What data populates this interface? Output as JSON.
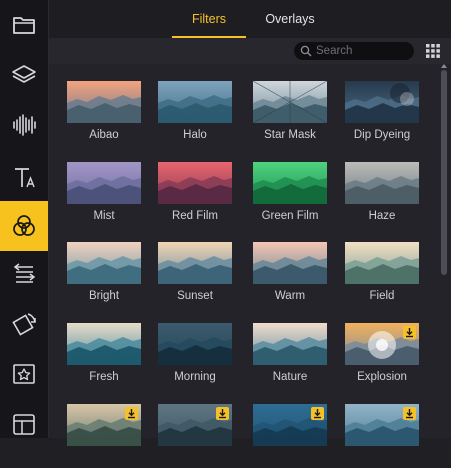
{
  "tabs": [
    {
      "label": "Filters"
    },
    {
      "label": "Overlays"
    }
  ],
  "search": {
    "placeholder": "Search"
  },
  "accent_color": "#f5c12a",
  "sidebar": {
    "items": [
      {
        "icon": "folder-icon"
      },
      {
        "icon": "layers-icon"
      },
      {
        "icon": "audio-waveform-icon"
      },
      {
        "icon": "text-icon"
      },
      {
        "icon": "filters-circles-icon",
        "active": true
      },
      {
        "icon": "transitions-icon"
      },
      {
        "icon": "rotate-square-icon"
      },
      {
        "icon": "star-sticker-icon"
      },
      {
        "icon": "template-icon"
      }
    ]
  },
  "filters": [
    {
      "label": "Aibao",
      "download": false
    },
    {
      "label": "Halo",
      "download": false
    },
    {
      "label": "Star Mask",
      "download": false
    },
    {
      "label": "Dip Dyeing",
      "download": false
    },
    {
      "label": "Mist",
      "download": false
    },
    {
      "label": "Red Film",
      "download": false
    },
    {
      "label": "Green Film",
      "download": false
    },
    {
      "label": "Haze",
      "download": false
    },
    {
      "label": "Bright",
      "download": false
    },
    {
      "label": "Sunset",
      "download": false
    },
    {
      "label": "Warm",
      "download": false
    },
    {
      "label": "Field",
      "download": false
    },
    {
      "label": "Fresh",
      "download": false
    },
    {
      "label": "Morning",
      "download": false
    },
    {
      "label": "Nature",
      "download": false
    },
    {
      "label": "Explosion",
      "download": true
    },
    {
      "label": "",
      "download": true
    },
    {
      "label": "",
      "download": true
    },
    {
      "label": "",
      "download": true
    },
    {
      "label": "",
      "download": true
    }
  ]
}
